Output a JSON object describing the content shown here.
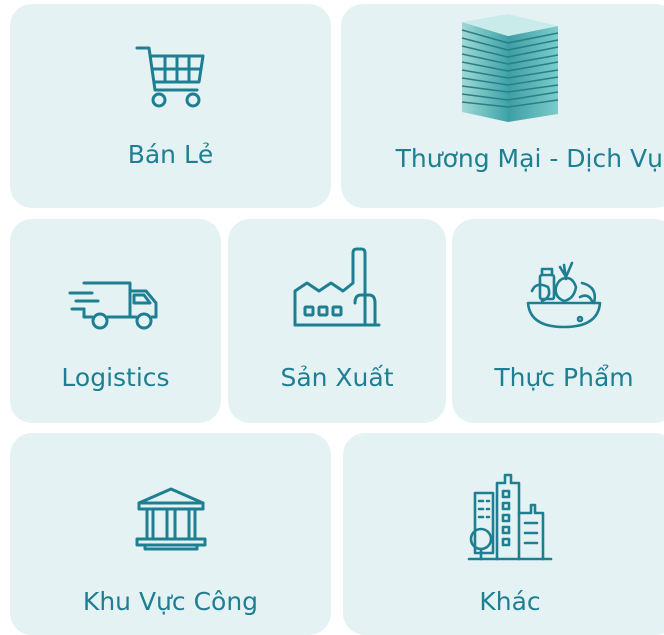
{
  "accent_color": "#1e7f92",
  "card_background": "#e5f2f4",
  "categories": [
    {
      "id": "retail",
      "label": "Bán Lẻ",
      "icon": "shopping-cart-icon"
    },
    {
      "id": "commerce",
      "label": "Thương Mại - Dịch Vụ",
      "icon": "office-building-icon"
    },
    {
      "id": "logistics",
      "label": "Logistics",
      "icon": "delivery-truck-icon"
    },
    {
      "id": "manufacturing",
      "label": "Sản Xuất",
      "icon": "factory-icon"
    },
    {
      "id": "food",
      "label": "Thực Phẩm",
      "icon": "food-bowl-icon"
    },
    {
      "id": "public",
      "label": "Khu Vực Công",
      "icon": "government-building-icon"
    },
    {
      "id": "other",
      "label": "Khác",
      "icon": "city-buildings-icon"
    }
  ]
}
